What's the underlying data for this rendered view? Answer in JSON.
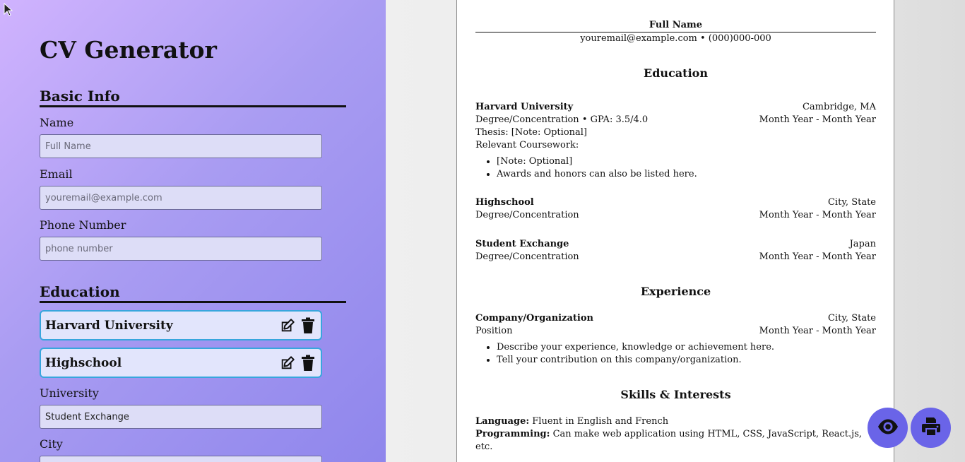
{
  "app": {
    "title": "CV Generator"
  },
  "basic_info": {
    "heading": "Basic Info",
    "name": {
      "label": "Name",
      "placeholder": "Full Name",
      "value": ""
    },
    "email": {
      "label": "Email",
      "placeholder": "youremail@example.com",
      "value": ""
    },
    "phone": {
      "label": "Phone Number",
      "placeholder": "phone number",
      "value": ""
    }
  },
  "education_form": {
    "heading": "Education",
    "items": [
      {
        "name": "Harvard University"
      },
      {
        "name": "Highschool"
      }
    ],
    "university": {
      "label": "University",
      "value": "Student Exchange"
    },
    "city": {
      "label": "City"
    }
  },
  "cv": {
    "name": "Full Name",
    "contact": "youremail@example.com • (000)000-000",
    "education_heading": "Education",
    "education": [
      {
        "school": "Harvard University",
        "location": "Cambridge, MA",
        "degree": "Degree/Concentration • GPA: 3.5/4.0",
        "dates": "Month Year - Month Year",
        "thesis": "Thesis: [Note: Optional]",
        "coursework": "Relevant Coursework:",
        "bullets": [
          "[Note: Optional]",
          "Awards and honors can also be listed here."
        ]
      },
      {
        "school": "Highschool",
        "location": "City, State",
        "degree": "Degree/Concentration",
        "dates": "Month Year - Month Year"
      },
      {
        "school": "Student Exchange",
        "location": "Japan",
        "degree": "Degree/Concentration",
        "dates": "Month Year - Month Year"
      }
    ],
    "experience_heading": "Experience",
    "experience": {
      "company": "Company/Organization",
      "location": "City, State",
      "position": "Position",
      "dates": "Month Year - Month Year",
      "bullets": [
        "Describe your experience, knowledge or achievement here.",
        "Tell your contribution on this company/organization."
      ]
    },
    "skills_heading": "Skills & Interests",
    "skills": [
      {
        "label": "Language:",
        "value": " Fluent in English and French"
      },
      {
        "label": "Programming:",
        "value": " Can make web application using HTML, CSS, JavaScript, React.js, etc."
      }
    ]
  },
  "icons": {
    "edit": "edit-icon",
    "delete": "trash-icon",
    "preview": "eye-icon",
    "print": "printer-icon",
    "cursor": "mouse-pointer-icon"
  },
  "colors": {
    "accent": "#6a64e8",
    "card_border": "#38a6dd",
    "card_bg": "#e2e5fc",
    "panel_gradient_start": "#d0b3fe",
    "panel_gradient_end": "#8f86ec"
  }
}
